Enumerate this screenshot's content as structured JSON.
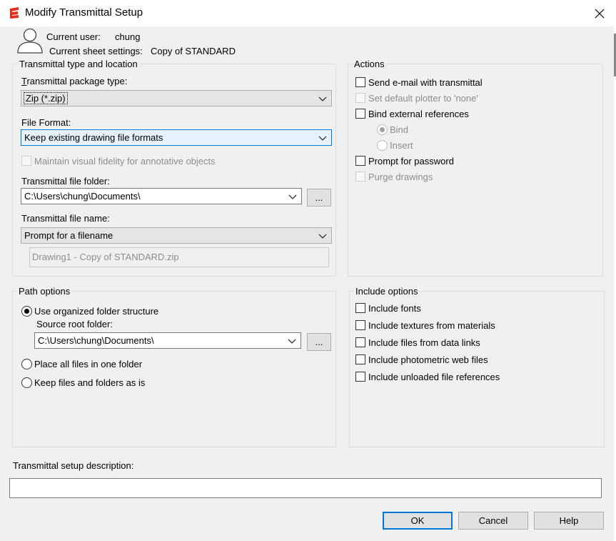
{
  "window": {
    "title": "Modify Transmittal Setup"
  },
  "user": {
    "current_user_label": "Current user:",
    "current_user_value": "chung",
    "sheet_settings_label": "Current sheet settings:",
    "sheet_settings_value": "Copy of STANDARD"
  },
  "transmittal_group": {
    "title": "Transmittal type and location",
    "package_type_label": "Transmittal package type:",
    "package_type_value": "Zip (*.zip)",
    "file_format_label": "File Format:",
    "file_format_value": "Keep existing drawing file formats",
    "maintain_fidelity_label": "Maintain visual fidelity for annotative objects",
    "folder_label": "Transmittal file folder:",
    "folder_value": "C:\\Users\\chung\\Documents\\",
    "browse_label": "...",
    "name_label": "Transmittal file name:",
    "name_value": "Prompt for a filename",
    "filename_preview": "Drawing1 - Copy of STANDARD.zip"
  },
  "actions_group": {
    "title": "Actions",
    "send_email": "Send e-mail with transmittal",
    "set_plotter": "Set default plotter to 'none'",
    "bind_xrefs": "Bind external references",
    "bind": "Bind",
    "insert": "Insert",
    "prompt_password": "Prompt for password",
    "purge": "Purge drawings"
  },
  "path_group": {
    "title": "Path options",
    "use_organized": "Use organized folder structure",
    "source_root_label": "Source root folder:",
    "source_root_value": "C:\\Users\\chung\\Documents\\",
    "browse_label": "...",
    "place_all": "Place all files in one folder",
    "keep_files": "Keep files and folders as is"
  },
  "include_group": {
    "title": "Include options",
    "fonts": "Include fonts",
    "textures": "Include textures from materials",
    "data_links": "Include files from data links",
    "photometric": "Include photometric web files",
    "unloaded": "Include unloaded file references"
  },
  "description": {
    "label": "Transmittal setup description:",
    "value": ""
  },
  "buttons": {
    "ok": "OK",
    "cancel": "Cancel",
    "help": "Help"
  },
  "colors": {
    "accent": "#0078d7",
    "background": "#f0f0f0",
    "logo": "#e0301e"
  }
}
